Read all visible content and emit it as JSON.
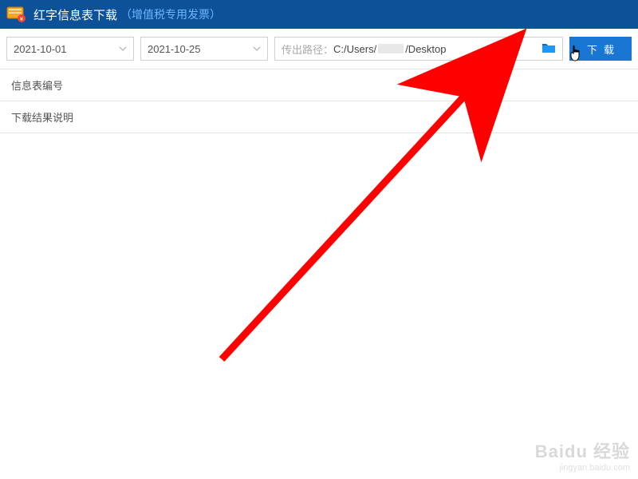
{
  "titlebar": {
    "title": "红字信息表下载",
    "subtitle": "（增值税专用发票）"
  },
  "toolbar": {
    "date_from": "2021-10-01",
    "date_to": "2021-10-25",
    "path_label": "传出路径：",
    "path_prefix": "C:/Users/",
    "path_suffix": "/Desktop",
    "download_label": "下载"
  },
  "sections": {
    "table_header": "信息表编号",
    "result_header": "下载结果说明"
  },
  "watermark": {
    "main": "Baidu 经验",
    "sub": "jingyan.baidu.com"
  }
}
